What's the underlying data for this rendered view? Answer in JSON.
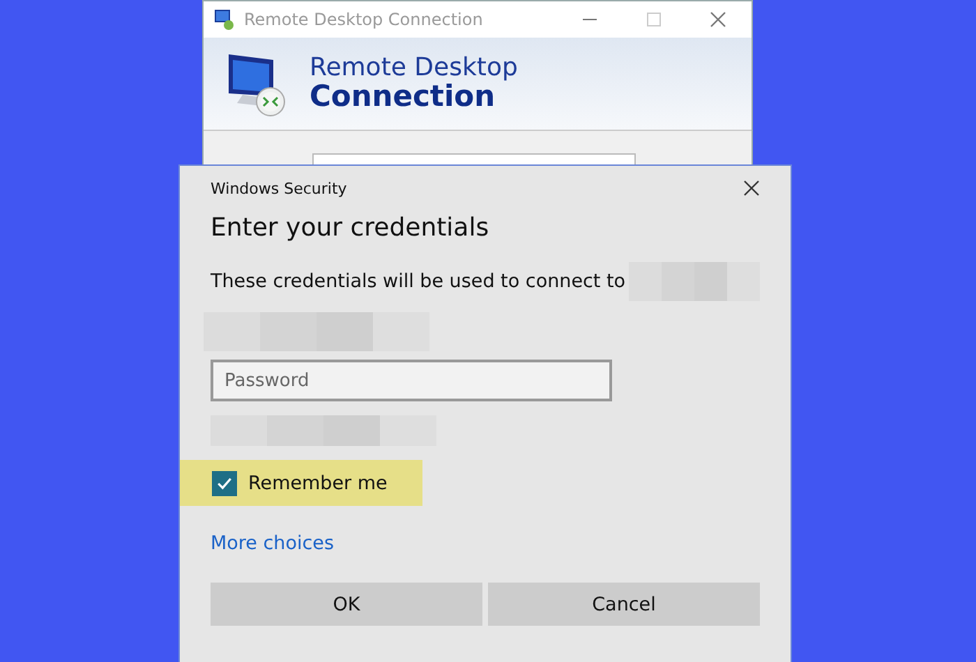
{
  "rdc_window": {
    "title": "Remote Desktop Connection",
    "banner_line1": "Remote Desktop",
    "banner_line2": "Connection"
  },
  "dialog": {
    "title": "Windows Security",
    "heading": "Enter your credentials",
    "message": "These credentials will be used to connect to",
    "password": {
      "placeholder": "Password"
    },
    "remember": {
      "label": "Remember me",
      "checked": true
    },
    "more_choices": "More choices",
    "buttons": [
      "OK",
      "Cancel"
    ]
  }
}
